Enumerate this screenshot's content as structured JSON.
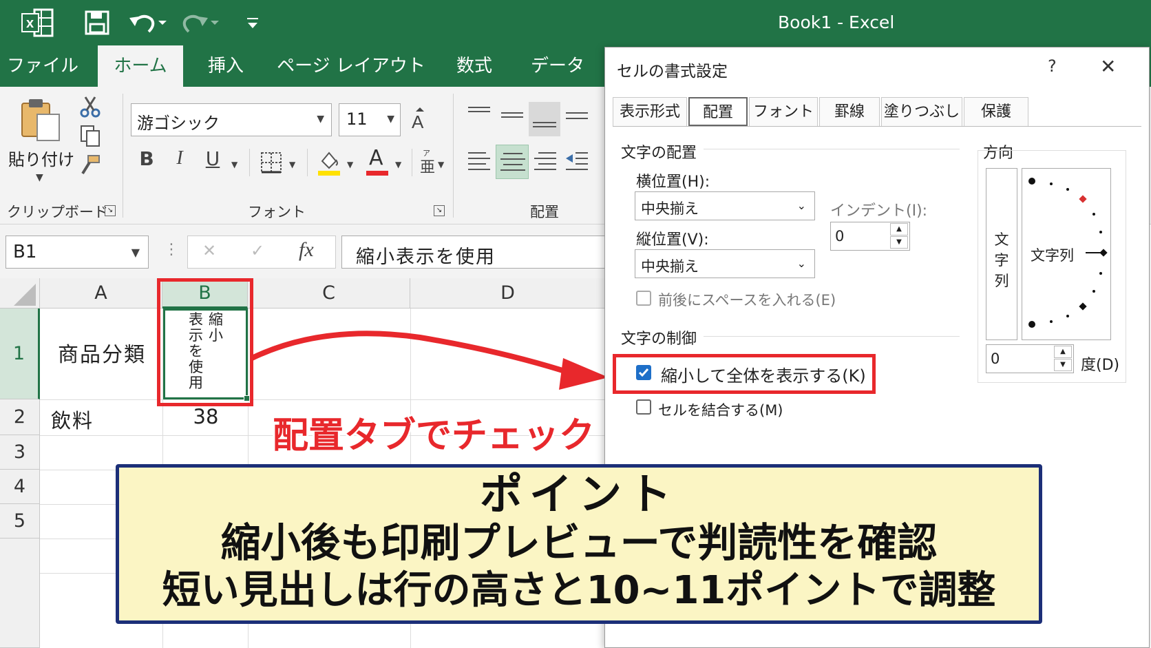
{
  "titlebar": {
    "title": "Book1  -  Excel",
    "excel_icon": "excel-logo-icon",
    "save_icon": "save-icon",
    "undo_icon": "undo-icon",
    "redo_icon": "redo-icon",
    "customize_icon": "customize-qat-icon"
  },
  "ribbon_tabs": [
    {
      "label": "ファイル"
    },
    {
      "label": "ホーム"
    },
    {
      "label": "挿入"
    },
    {
      "label": "ページ レイアウト"
    },
    {
      "label": "数式"
    },
    {
      "label": "データ"
    }
  ],
  "ribbon": {
    "paste_label": "貼り付け",
    "clipboard_label": "クリップボード",
    "font_label": "フォント",
    "alignment_label": "配置",
    "font_name": "游ゴシック",
    "font_size": "11",
    "bold": "B",
    "italic": "I",
    "underline": "U",
    "font_color": "A",
    "font_color_hex": "#e8282c",
    "fill_color_hex": "#ffe100"
  },
  "formula_bar": {
    "name_box": "B1",
    "cancel": "✕",
    "enter": "✓",
    "fx": "fx",
    "content": "縮小表示を使用"
  },
  "grid": {
    "columns": [
      "A",
      "B",
      "C",
      "D"
    ],
    "rows": [
      "1",
      "2",
      "3",
      "4",
      "5"
    ],
    "a1": "商品分類",
    "b1_lines": [
      "表縮",
      "示小",
      "を",
      "使",
      "用"
    ],
    "a2": "飲料",
    "b2": "38"
  },
  "dialog": {
    "title": "セルの書式設定",
    "help": "?",
    "close": "✕",
    "tabs": [
      {
        "label": "表示形式"
      },
      {
        "label": "配置"
      },
      {
        "label": "フォント"
      },
      {
        "label": "罫線"
      },
      {
        "label": "塗りつぶし"
      },
      {
        "label": "保護"
      }
    ],
    "alignment_section": "文字の配置",
    "horizontal_label": "横位置(H):",
    "horizontal_value": "中央揃え",
    "vertical_label": "縦位置(V):",
    "vertical_value": "中央揃え",
    "indent_label": "インデント(I):",
    "indent_value": "0",
    "distributed_label": "前後にスペースを入れる(E)",
    "control_section": "文字の制御",
    "shrink_label": "縮小して全体を表示する(K)",
    "shrink_checked": true,
    "merge_label": "セルを結合する(M)",
    "orientation_section": "方向",
    "vertical_text": [
      "文",
      "字",
      "列"
    ],
    "orientation_text": "文字列",
    "degree_value": "0",
    "degree_label": "度(D)"
  },
  "annotation": {
    "caption": "配置タブでチェック",
    "highlight_color": "#e8282c",
    "point_title": "ポイント",
    "point_line1": "縮小後も印刷プレビューで判読性を確認",
    "point_line2": "短い見出しは行の高さと10~11ポイントで調整"
  }
}
